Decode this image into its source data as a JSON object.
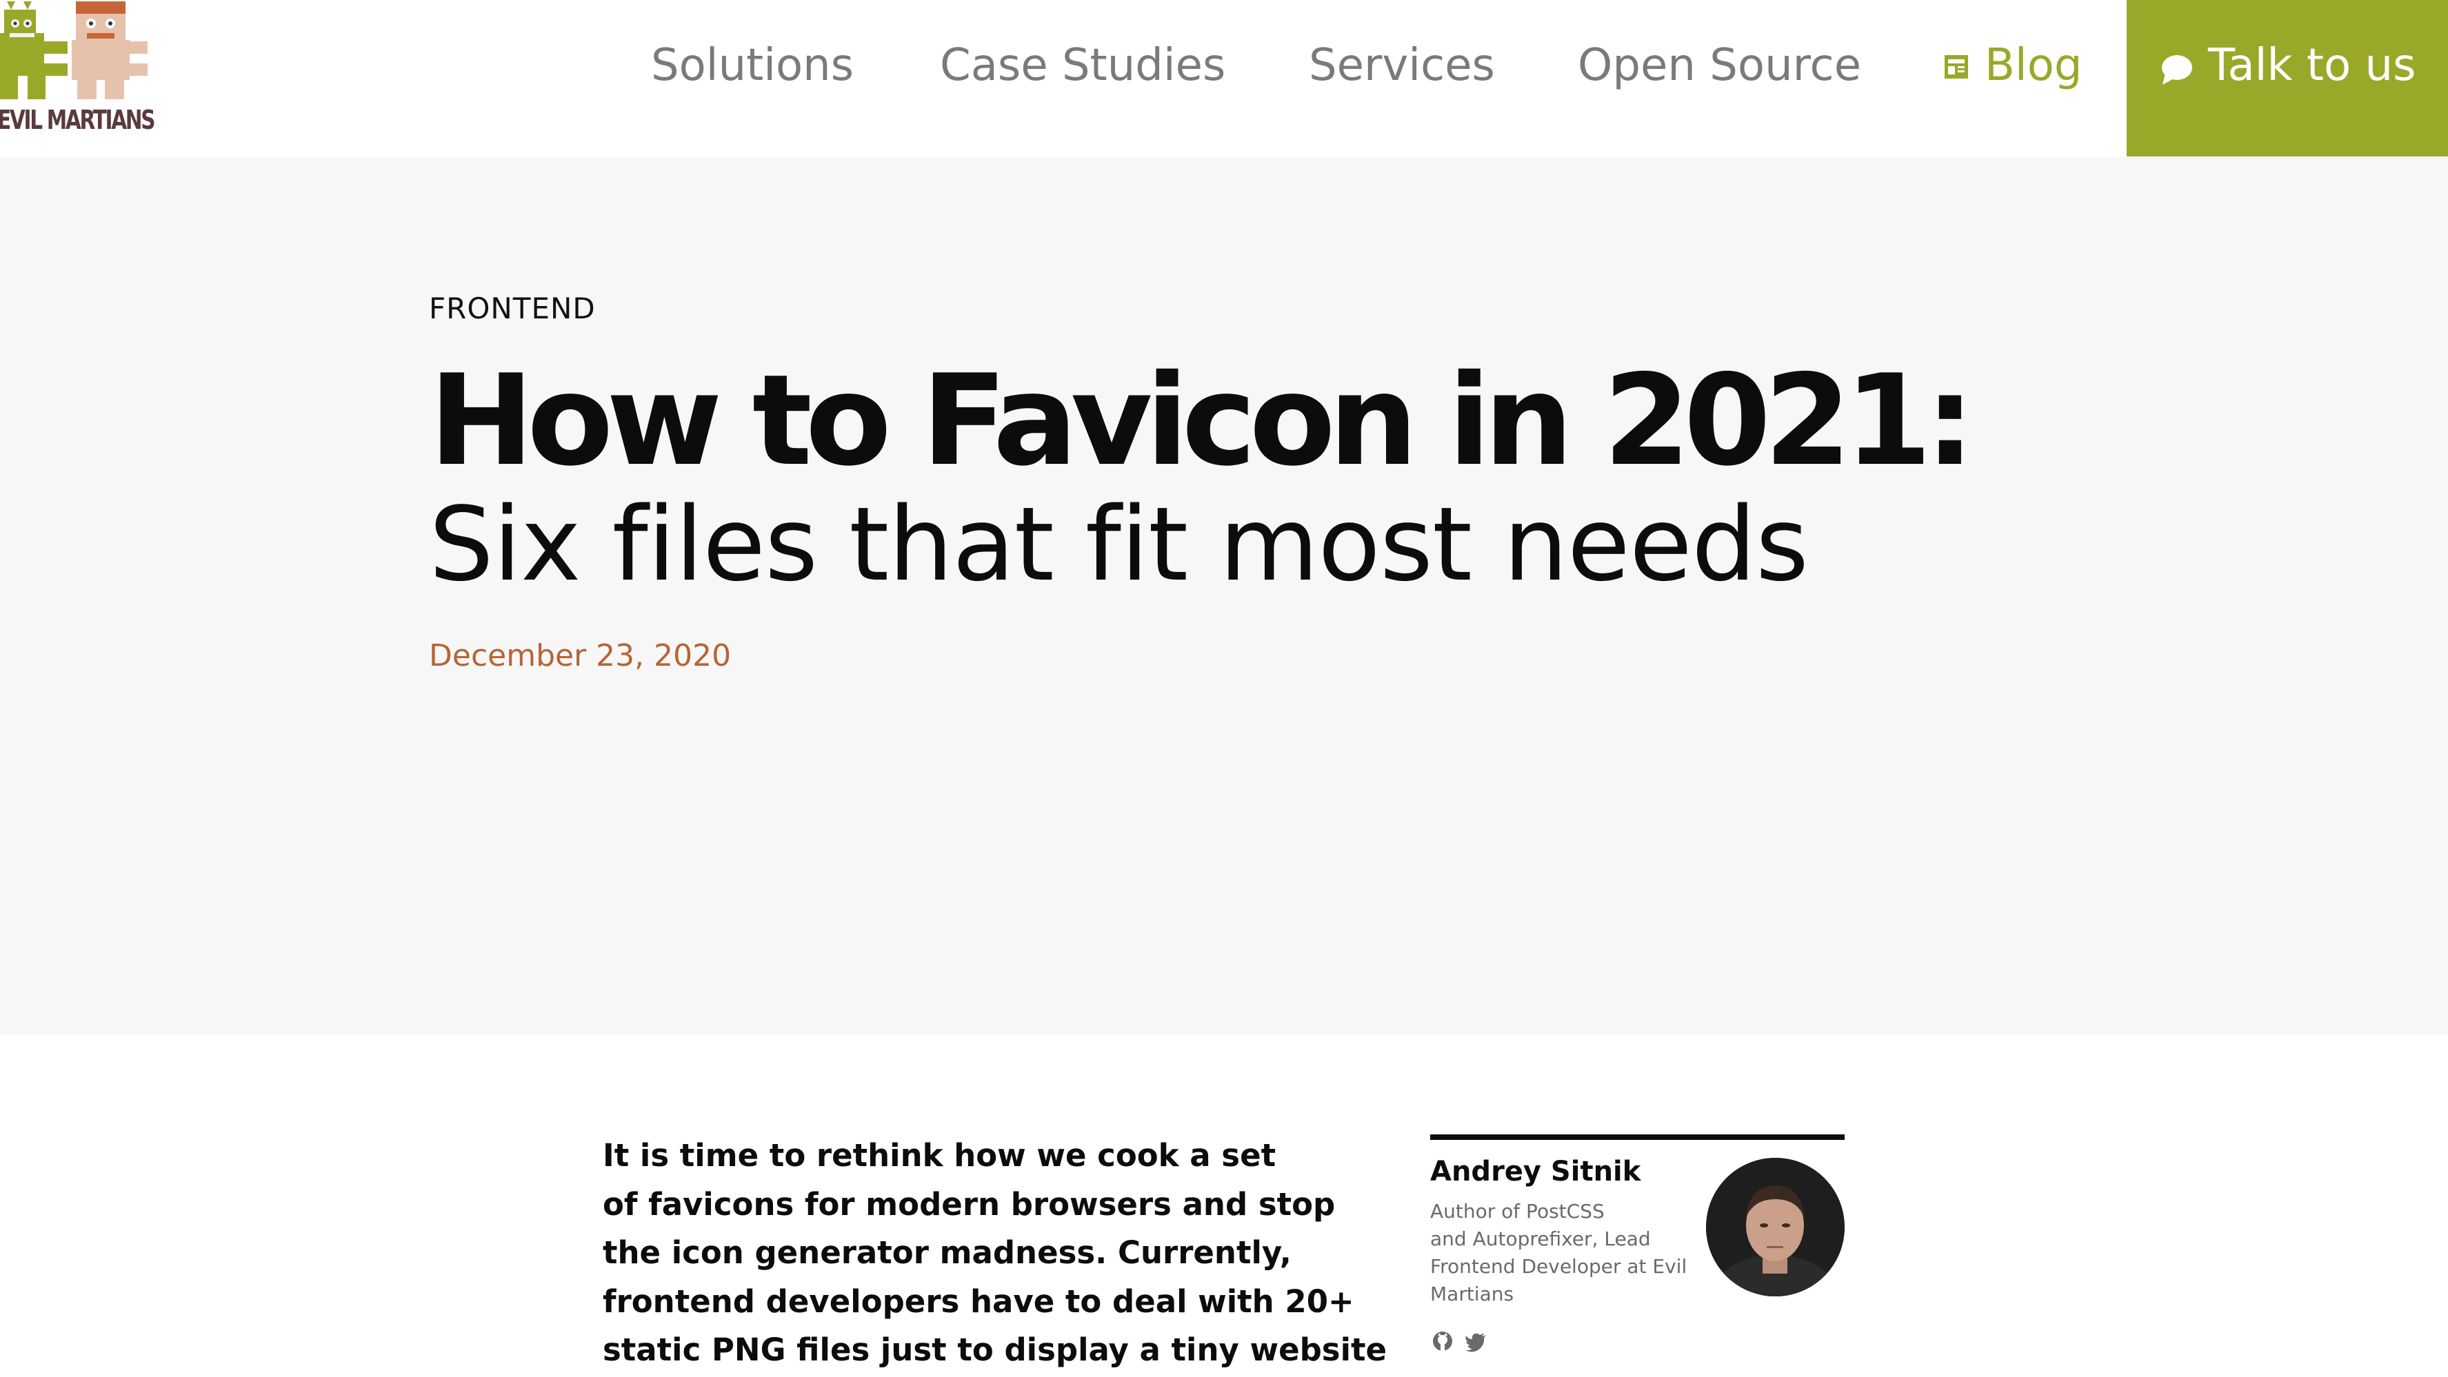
{
  "brand": {
    "name": "EVIL MARTIANS",
    "colors": {
      "accent": "#9aa82a",
      "date": "#b76434",
      "hero_bg": "#f7f7f7",
      "nav": "#7a7a7a"
    }
  },
  "nav": {
    "items": [
      {
        "label": "Solutions"
      },
      {
        "label": "Case Studies"
      },
      {
        "label": "Services"
      },
      {
        "label": "Open Source"
      }
    ],
    "blog": {
      "label": "Blog",
      "icon": "newspaper-icon"
    },
    "cta": {
      "label": "Talk to us",
      "icon": "speech-bubble-icon"
    }
  },
  "hero": {
    "category": "FRONTEND",
    "title": "How to Favicon in 2021:",
    "subtitle": "Six files that fit most needs",
    "date": "December 23, 2020"
  },
  "article": {
    "lead_lines": [
      "It is time to rethink how we cook a set",
      "of favicons for modern browsers and stop",
      "the icon generator madness. Currently,",
      "frontend developers have to deal with 20+",
      "static PNG files just to display a tiny website"
    ]
  },
  "author": {
    "name": "Andrey Sitnik",
    "bio_lines": [
      "Author of PostCSS",
      "and Autoprefixer, Lead",
      "Frontend Developer at Evil",
      "Martians"
    ],
    "social": [
      "github-icon",
      "twitter-icon"
    ]
  }
}
